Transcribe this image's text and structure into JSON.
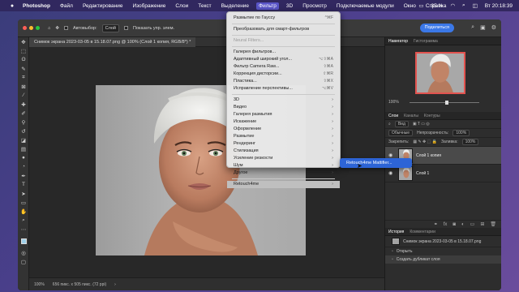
{
  "menubar": {
    "app": "Photoshop",
    "items": [
      "Файл",
      "Редактирование",
      "Изображение",
      "Слои",
      "Текст",
      "Выделение",
      "Фильтр",
      "3D",
      "Просмотр",
      "Подключаемые модули",
      "Окно",
      "Справка"
    ],
    "active_item": "Фильтр",
    "battery": "35 %",
    "clock": "Вт 20:18:39"
  },
  "options_bar": {
    "autoselect_label": "Автовыбор:",
    "autoselect_value": "Слой",
    "show_controls_label": "Показать упр. элем.",
    "share_button": "Поделиться"
  },
  "document": {
    "tab_title": "Снимок экрана 2023-03-05 в 15.18.07.png @ 100% (Слой 1 копия, RGB/8*) *",
    "zoom": "100%",
    "doc_info": "656 пикс. x 505 пикс. (72 ppi)"
  },
  "filter_menu": {
    "items": [
      {
        "label": "Размытие по Гауссу",
        "shortcut": "^⌘F",
        "type": "item"
      },
      {
        "type": "sep"
      },
      {
        "label": "Преобразовать для смарт-фильтров",
        "type": "item"
      },
      {
        "type": "sep"
      },
      {
        "label": "Neural Filters...",
        "type": "disabled"
      },
      {
        "type": "sep"
      },
      {
        "label": "Галерея фильтров...",
        "type": "item"
      },
      {
        "label": "Адаптивный широкий угол...",
        "shortcut": "⌥⇧⌘A",
        "type": "item"
      },
      {
        "label": "Фильтр Camera Raw...",
        "shortcut": "⇧⌘A",
        "type": "item"
      },
      {
        "label": "Коррекция дисторсии...",
        "shortcut": "⇧⌘R",
        "type": "item"
      },
      {
        "label": "Пластика...",
        "shortcut": "⇧⌘X",
        "type": "item"
      },
      {
        "label": "Исправление перспективы...",
        "shortcut": "⌥⌘V",
        "type": "item"
      },
      {
        "type": "sep"
      },
      {
        "label": "3D",
        "type": "submenu"
      },
      {
        "label": "Видео",
        "type": "submenu"
      },
      {
        "label": "Галерея размытия",
        "type": "submenu"
      },
      {
        "label": "Искажение",
        "type": "submenu"
      },
      {
        "label": "Оформление",
        "type": "submenu"
      },
      {
        "label": "Размытие",
        "type": "submenu"
      },
      {
        "label": "Рендеринг",
        "type": "submenu"
      },
      {
        "label": "Стилизация",
        "type": "submenu"
      },
      {
        "label": "Усиление резкости",
        "type": "submenu"
      },
      {
        "label": "Шум",
        "type": "submenu"
      },
      {
        "label": "Другое",
        "type": "submenu"
      },
      {
        "type": "sep"
      },
      {
        "label": "Retouch4me",
        "type": "submenu-open"
      }
    ]
  },
  "submenu": {
    "item": "Retouch4me Mattifier..."
  },
  "panels": {
    "navigator_tabs": [
      "Навигатор",
      "Гистограмма"
    ],
    "nav_zoom": "100%",
    "layers_tabs": [
      "Слои",
      "Каналы",
      "Контуры"
    ],
    "kind_label": "Вид",
    "blend_mode": "Обычные",
    "opacity_label": "Непрозрачность:",
    "opacity_value": "100%",
    "lock_label": "Закрепить:",
    "fill_label": "Заливка:",
    "fill_value": "100%",
    "layers": [
      {
        "name": "Слой 1 копия",
        "selected": true
      },
      {
        "name": "Слой 1",
        "selected": false
      }
    ],
    "history_tabs": [
      "История",
      "Комментарии"
    ],
    "history_snapshot": "Снимок экрана 2023-03-05 в 15.18.07.png",
    "history_items": [
      "Открыть",
      "Создать дубликат слоя"
    ]
  },
  "colors": {
    "menu_highlight": "#2d64d6",
    "share_blue": "#3b78e7",
    "nav_frame": "#e2534f"
  }
}
